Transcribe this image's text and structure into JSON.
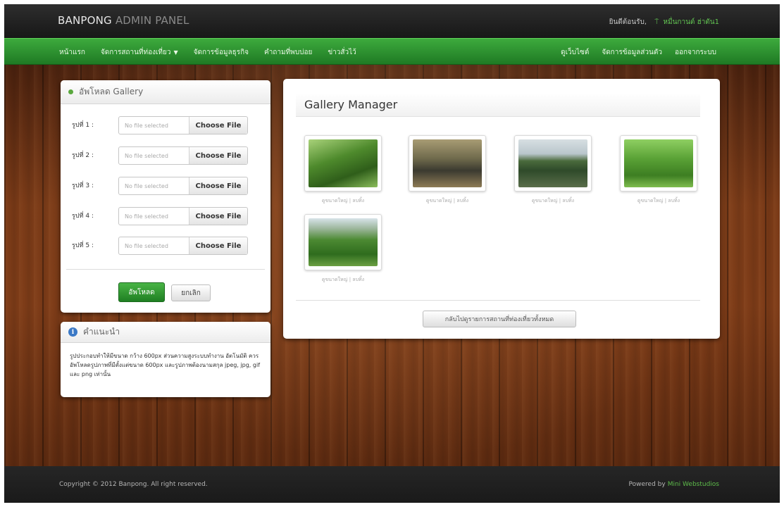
{
  "topbar": {
    "brand_main": "BANPONG",
    "brand_sub": " ADMIN PANEL",
    "welcome": "ยินดีต้อนรับ,",
    "person_icon": "person-icon",
    "username": "หมื่นกานต์ ฮ่าตัน1"
  },
  "nav": {
    "left": [
      {
        "label": "หน้าแรก"
      },
      {
        "label": "จัดการสถานที่ท่องเที่ยว",
        "caret": "▼"
      },
      {
        "label": "จัดการข้อมูลธุรกิจ"
      },
      {
        "label": "คำถามที่พบบ่อย"
      },
      {
        "label": "ข่าวสั่วไว้"
      }
    ],
    "right": [
      {
        "label": "ดูเว็บไซต์"
      },
      {
        "label": "จัดการข้อมูลส่วนตัว"
      },
      {
        "label": "ออกจากระบบ"
      }
    ]
  },
  "upload": {
    "title": "อัพโหลด Gallery",
    "status_placeholder": "No file selected",
    "choose_label": "Choose File",
    "fields": [
      {
        "label": "รูปที่ 1 :"
      },
      {
        "label": "รูปที่ 2 :"
      },
      {
        "label": "รูปที่ 3 :"
      },
      {
        "label": "รูปที่ 4 :"
      },
      {
        "label": "รูปที่ 5 :"
      }
    ],
    "upload_button": "อัพโหลด",
    "cancel_button": "ยกเลิก"
  },
  "help": {
    "title": "คำแนะนำ",
    "icon": "info-icon",
    "text": "รูปประกอบทำให้มีขนาด กว้าง 600px ส่วนความสูงระบบทำงาน อัตโนมัติ ควรอัพโหลดรูปภาพที่มีตั้งแต่ขนาด 600px และรูปภาพต้องนามสกุล jpeg, jpg, gif และ png เท่านั้น"
  },
  "gallery": {
    "title": "Gallery Manager",
    "items": [
      {
        "caption": "ดูขนาดใหญ่ | ลบทิ้ง",
        "image": "farmers in green field"
      },
      {
        "caption": "ดูขนาดใหญ่ | ลบทิ้ง",
        "image": "elephants at camp"
      },
      {
        "caption": "ดูขนาดใหญ่ | ลบทิ้ง",
        "image": "reservoir lake"
      },
      {
        "caption": "ดูขนาดใหญ่ | ลบทิ้ง",
        "image": "green vegetables"
      },
      {
        "caption": "ดูขนาดใหญ่ | ลบทิ้ง",
        "image": "person in vegetable field"
      }
    ],
    "back_button": "กลับไปดูรายการสถานที่ท่องเที่ยวทั้งหมด"
  },
  "footer": {
    "copyright": "Copyright © 2012 Banpong. All right reserved.",
    "powered_prefix": "Powered by",
    "powered_author": "Mini Webstudios"
  },
  "colors": {
    "nav_green": "#2e9a33",
    "accent_green": "#62c452",
    "info_blue": "#3b79c6"
  }
}
